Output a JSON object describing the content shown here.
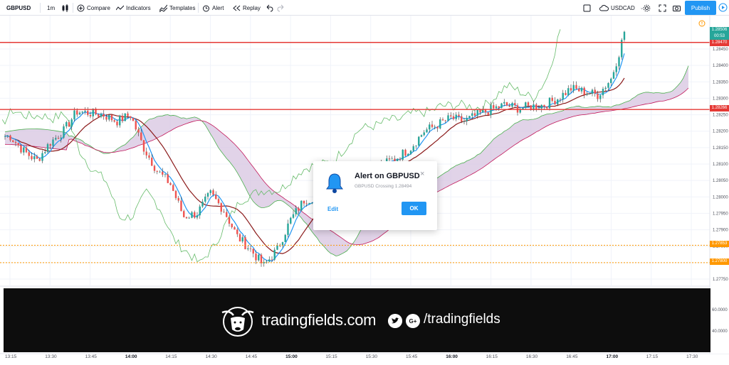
{
  "toolbar": {
    "symbol": "GBPUSD",
    "interval": "1m",
    "compare": "Compare",
    "indicators": "Indicators",
    "templates": "Templates",
    "alert": "Alert",
    "replay": "Replay",
    "watch_symbol": "USDCAD",
    "publish": "Publish"
  },
  "chart_data": {
    "type": "candlestick",
    "symbol": "GBPUSD",
    "interval": "1m",
    "price_axis_ticks": [
      "1.28450",
      "1.28400",
      "1.28350",
      "1.28300",
      "1.28250",
      "1.28200",
      "1.28150",
      "1.28100",
      "1.28050",
      "1.28000",
      "1.27950",
      "1.27900",
      "1.27850",
      "1.27800",
      "1.27750"
    ],
    "indicator_axis_ticks": [
      "60.0000",
      "40.0000"
    ],
    "time_ticks": [
      {
        "label": "13:15",
        "bold": false
      },
      {
        "label": "13:30",
        "bold": false
      },
      {
        "label": "13:45",
        "bold": false
      },
      {
        "label": "14:00",
        "bold": true
      },
      {
        "label": "14:15",
        "bold": false
      },
      {
        "label": "14:30",
        "bold": false
      },
      {
        "label": "14:45",
        "bold": false
      },
      {
        "label": "15:00",
        "bold": true
      },
      {
        "label": "15:15",
        "bold": false
      },
      {
        "label": "15:30",
        "bold": false
      },
      {
        "label": "15:45",
        "bold": false
      },
      {
        "label": "16:00",
        "bold": true
      },
      {
        "label": "16:15",
        "bold": false
      },
      {
        "label": "16:30",
        "bold": false
      },
      {
        "label": "16:45",
        "bold": false
      },
      {
        "label": "17:00",
        "bold": true
      },
      {
        "label": "17:15",
        "bold": false
      },
      {
        "label": "17:30",
        "bold": false
      }
    ],
    "horizontal_lines": [
      {
        "price": 1.2847,
        "color": "#e53935",
        "style": "solid",
        "tag": "1.28470"
      },
      {
        "price": 1.28266,
        "color": "#e53935",
        "style": "solid",
        "tag": "1.28266"
      },
      {
        "price": 1.27853,
        "color": "#ff9800",
        "style": "dotted",
        "tag": "1.27853"
      },
      {
        "price": 1.278,
        "color": "#ff9800",
        "style": "dotted",
        "tag": "1.27800"
      }
    ],
    "last_price": "1.28506",
    "countdown": "00:53",
    "price_path": [
      {
        "t": "13:15",
        "p": 1.28185
      },
      {
        "t": "13:20",
        "p": 1.2814
      },
      {
        "t": "13:25",
        "p": 1.2811
      },
      {
        "t": "13:30",
        "p": 1.28165
      },
      {
        "t": "13:35",
        "p": 1.282
      },
      {
        "t": "13:40",
        "p": 1.2826
      },
      {
        "t": "13:45",
        "p": 1.28255
      },
      {
        "t": "13:50",
        "p": 1.2825
      },
      {
        "t": "13:55",
        "p": 1.2823
      },
      {
        "t": "14:00",
        "p": 1.2825
      },
      {
        "t": "14:05",
        "p": 1.2815
      },
      {
        "t": "14:10",
        "p": 1.2808
      },
      {
        "t": "14:15",
        "p": 1.2804
      },
      {
        "t": "14:20",
        "p": 1.2794
      },
      {
        "t": "14:25",
        "p": 1.2795
      },
      {
        "t": "14:30",
        "p": 1.2801
      },
      {
        "t": "14:35",
        "p": 1.2796
      },
      {
        "t": "14:40",
        "p": 1.2788
      },
      {
        "t": "14:45",
        "p": 1.2784
      },
      {
        "t": "14:50",
        "p": 1.2779
      },
      {
        "t": "14:55",
        "p": 1.2784
      },
      {
        "t": "15:00",
        "p": 1.2793
      },
      {
        "t": "15:05",
        "p": 1.2799
      },
      {
        "t": "15:10",
        "p": 1.28
      },
      {
        "t": "15:15",
        "p": 1.2802
      },
      {
        "t": "15:20",
        "p": 1.2803
      },
      {
        "t": "15:25",
        "p": 1.2806
      },
      {
        "t": "15:30",
        "p": 1.2808
      },
      {
        "t": "15:35",
        "p": 1.281
      },
      {
        "t": "15:40",
        "p": 1.2812
      },
      {
        "t": "15:45",
        "p": 1.2815
      },
      {
        "t": "15:50",
        "p": 1.282
      },
      {
        "t": "15:55",
        "p": 1.2822
      },
      {
        "t": "16:00",
        "p": 1.2824
      },
      {
        "t": "16:05",
        "p": 1.2823
      },
      {
        "t": "16:10",
        "p": 1.2825
      },
      {
        "t": "16:15",
        "p": 1.28265
      },
      {
        "t": "16:20",
        "p": 1.2828
      },
      {
        "t": "16:25",
        "p": 1.2827
      },
      {
        "t": "16:30",
        "p": 1.28275
      },
      {
        "t": "16:35",
        "p": 1.2828
      },
      {
        "t": "16:40",
        "p": 1.283
      },
      {
        "t": "16:45",
        "p": 1.2833
      },
      {
        "t": "16:50",
        "p": 1.2832
      },
      {
        "t": "16:55",
        "p": 1.2831
      },
      {
        "t": "17:00",
        "p": 1.2836
      },
      {
        "t": "17:03",
        "p": 1.2844
      },
      {
        "t": "17:05",
        "p": 1.28506
      }
    ]
  },
  "dialog": {
    "title": "Alert on GBPUSD",
    "subtitle": "GBPUSD Crossing 1.28494",
    "close": "×",
    "edit": "Edit",
    "ok": "OK"
  },
  "banner": {
    "site": "tradingfields.com",
    "handle": "/tradingfields",
    "gplus": "G+"
  },
  "colors": {
    "accent": "#2196f3",
    "up": "#26a69a",
    "down": "#ef5350",
    "hline_red": "#e53935",
    "hline_orange": "#ff9800",
    "cloud": "#d7c4e0"
  }
}
